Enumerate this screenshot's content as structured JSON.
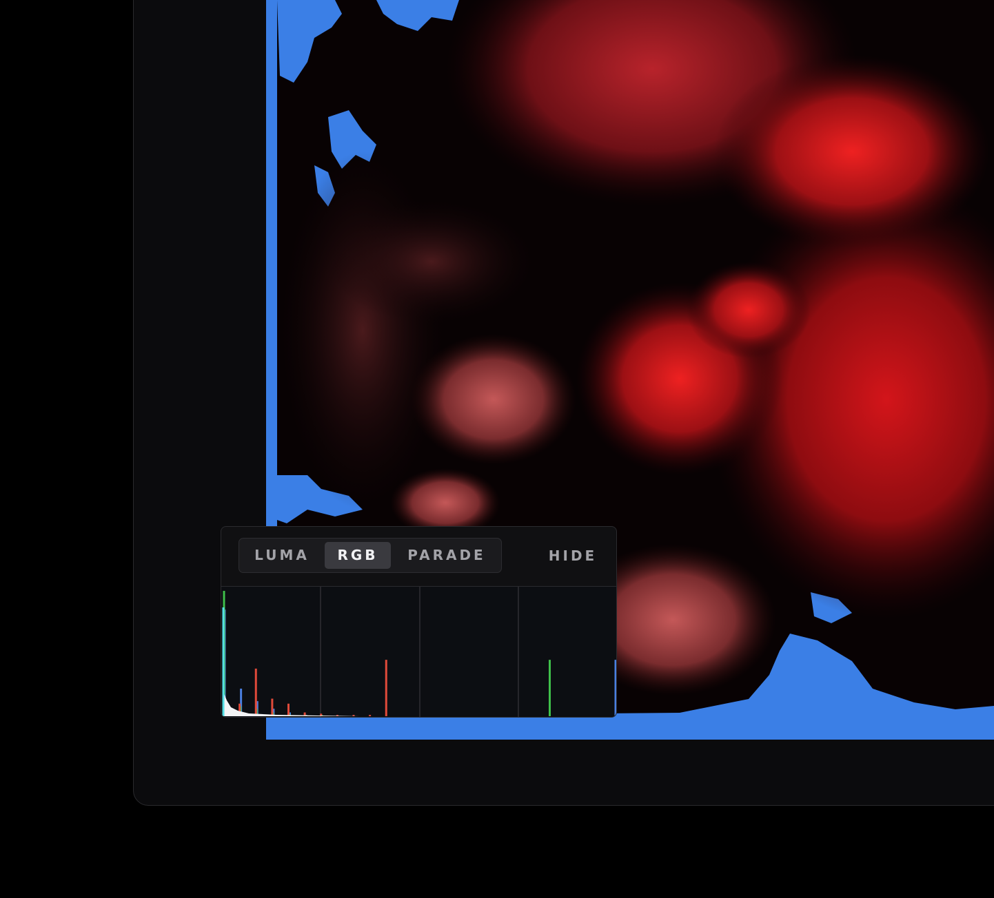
{
  "scopes": {
    "tabs": [
      {
        "label": "LUMA",
        "active": false
      },
      {
        "label": "RGB",
        "active": true
      },
      {
        "label": "PARADE",
        "active": false
      }
    ],
    "hide_label": "HIDE",
    "histogram": {
      "red": [
        0,
        10,
        38,
        14,
        10,
        3,
        2,
        1,
        1,
        1,
        45,
        0,
        0,
        0,
        0,
        0,
        0,
        0,
        0,
        0,
        0,
        0,
        0,
        0,
        0
      ],
      "green": [
        100,
        8,
        6,
        3,
        2,
        1,
        1,
        0,
        0,
        0,
        0,
        0,
        0,
        0,
        0,
        0,
        0,
        0,
        0,
        0,
        45,
        0,
        0,
        0,
        0
      ],
      "blue": [
        85,
        22,
        12,
        6,
        3,
        1,
        0,
        0,
        0,
        0,
        0,
        0,
        0,
        0,
        0,
        0,
        0,
        0,
        0,
        0,
        0,
        0,
        0,
        0,
        45
      ]
    }
  },
  "colors": {
    "accent_blue": "#3b7fe6",
    "frame_bg": "#0b0b0d",
    "panel_bg": "#101012"
  }
}
